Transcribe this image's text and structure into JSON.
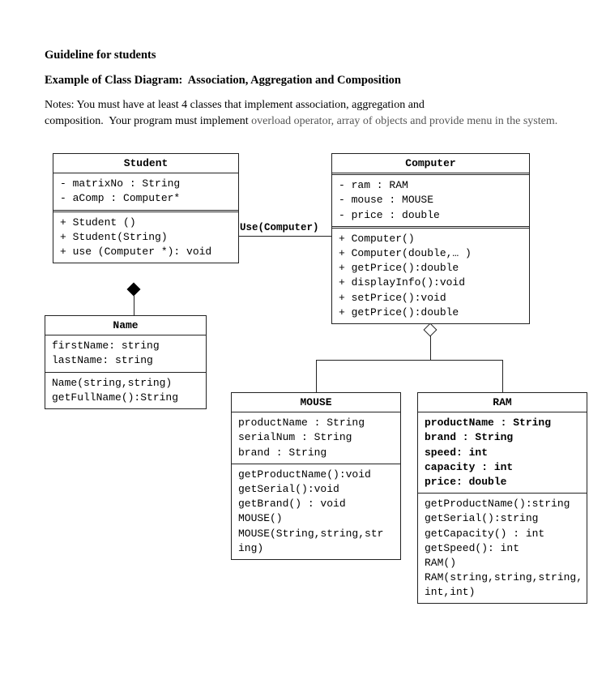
{
  "headings": {
    "h1": "Guideline for students",
    "h2": "Example of Class Diagram:  Association, Aggregation and Composition"
  },
  "notes": {
    "line1": "Notes: You must have at least 4 classes that implement association, aggregation and",
    "line2_black": "composition.  Your program must implement ",
    "line2_grey": "overload operator, array of objects and provide menu in the system."
  },
  "labels": {
    "use_computer": "Use(Computer)"
  },
  "classes": {
    "student": {
      "name": "Student",
      "attrs": "- matrixNo : String\n- aComp : Computer*",
      "ops": "+ Student ()\n+ Student(String)\n+ use (Computer *): void"
    },
    "computer": {
      "name": "Computer",
      "attrs": "- ram : RAM\n- mouse : MOUSE\n- price : double",
      "ops": "+ Computer()\n+ Computer(double,… )\n+ getPrice():double\n+ displayInfo():void\n+ setPrice():void\n+ getPrice():double"
    },
    "nameClass": {
      "name": "Name",
      "attrs": "firstName: string\nlastName: string",
      "ops": "Name(string,string)\ngetFullName():String"
    },
    "mouse": {
      "name": "MOUSE",
      "attrs": "productName : String\nserialNum : String\nbrand : String",
      "ops": "getProductName():void\ngetSerial():void\ngetBrand() : void\nMOUSE()\nMOUSE(String,string,str\ning)"
    },
    "ram": {
      "name": "RAM",
      "attrs_bold": "productName : String\nbrand : String\nspeed: int\ncapacity : int\nprice: double",
      "ops": "getProductName():string\ngetSerial():string\ngetCapacity() : int\ngetSpeed(): int\nRAM()\nRAM(string,string,string,\nint,int)"
    }
  }
}
